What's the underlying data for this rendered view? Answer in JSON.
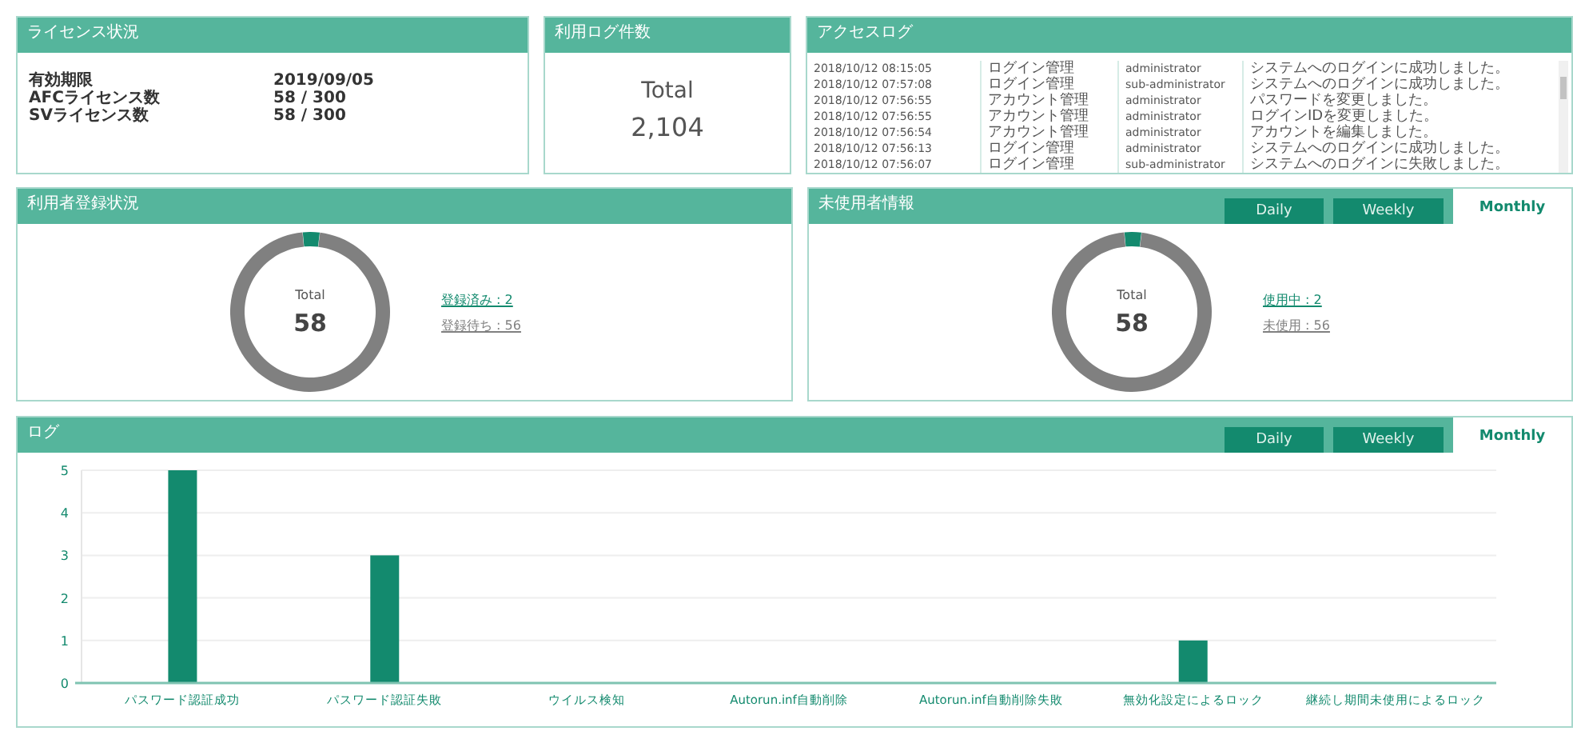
{
  "license_panel": {
    "title": "ライセンス状況",
    "rows": [
      {
        "label": "有効期限",
        "value": "2019/09/05"
      },
      {
        "label": "AFCライセンス数",
        "value": "58 / 300"
      },
      {
        "label": "SVライセンス数",
        "value": "58 / 300"
      }
    ]
  },
  "log_count_panel": {
    "title": "利用ログ件数",
    "caption": "Total",
    "value": "2,104"
  },
  "access_log_panel": {
    "title": "アクセスログ",
    "rows": [
      {
        "time": "2018/10/12 08:15:05",
        "category": "ログイン管理",
        "user": "administrator",
        "message": "システムへのログインに成功しました。"
      },
      {
        "time": "2018/10/12 07:57:08",
        "category": "ログイン管理",
        "user": "sub-administrator",
        "message": "システムへのログインに成功しました。"
      },
      {
        "time": "2018/10/12 07:56:55",
        "category": "アカウント管理",
        "user": "administrator",
        "message": "パスワードを変更しました。"
      },
      {
        "time": "2018/10/12 07:56:55",
        "category": "アカウント管理",
        "user": "administrator",
        "message": "ログインIDを変更しました。"
      },
      {
        "time": "2018/10/12 07:56:54",
        "category": "アカウント管理",
        "user": "administrator",
        "message": "アカウントを編集しました。"
      },
      {
        "time": "2018/10/12 07:56:13",
        "category": "ログイン管理",
        "user": "administrator",
        "message": "システムへのログインに成功しました。"
      },
      {
        "time": "2018/10/12 07:56:07",
        "category": "ログイン管理",
        "user": "sub-administrator",
        "message": "システムへのログインに失敗しました。"
      }
    ]
  },
  "user_registration_panel": {
    "title": "利用者登録状況",
    "donut": {
      "caption": "Total",
      "total": "58"
    },
    "chart_data": {
      "type": "donut",
      "values": [
        3.45,
        96.55
      ]
    },
    "legend": [
      {
        "label": "登録済み : 2",
        "color": "#138a6e"
      },
      {
        "label": "登録待ち : 56",
        "color": "#808080"
      }
    ]
  },
  "unused_user_panel": {
    "title": "未使用者情報",
    "tabs": [
      {
        "label": "Daily",
        "selected": false
      },
      {
        "label": "Weekly",
        "selected": false
      },
      {
        "label": "Monthly",
        "selected": true
      }
    ],
    "donut": {
      "caption": "Total",
      "total": "58"
    },
    "chart_data": {
      "type": "donut",
      "values": [
        3.45,
        96.55
      ]
    },
    "legend": [
      {
        "label": "使用中 : 2",
        "color": "#138a6e"
      },
      {
        "label": "未使用 : 56",
        "color": "#808080"
      }
    ]
  },
  "log_panel": {
    "title": "ログ",
    "tabs": [
      {
        "label": "Daily",
        "selected": false
      },
      {
        "label": "Weekly",
        "selected": false
      },
      {
        "label": "Monthly",
        "selected": true
      }
    ],
    "chart_data": {
      "type": "bar",
      "categories": [
        "パスワード認証成功",
        "パスワード認証失敗",
        "ウイルス検知",
        "Autorun.inf自動削除",
        "Autorun.inf自動削除失敗",
        "無効化設定によるロック",
        "継続し期間未使用によるロック"
      ],
      "series": [
        {
          "color": "#138a6e",
          "values": [
            5,
            3,
            0,
            0,
            0,
            1,
            0
          ]
        }
      ],
      "ylim": [
        0,
        5
      ],
      "yticks": [
        0,
        1,
        2,
        3,
        4,
        5
      ],
      "grid": true
    }
  }
}
